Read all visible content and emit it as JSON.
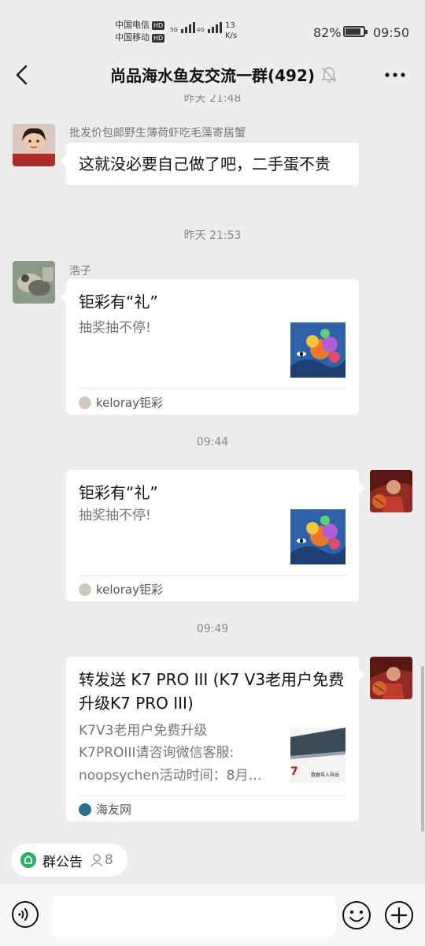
{
  "status_bar": {
    "carrier1": "中国电信",
    "carrier2": "中国移动",
    "hd": "HD",
    "net1": "5G",
    "net2": "4G",
    "speed_value": "13",
    "speed_unit": "K/s",
    "battery": "82%",
    "time": "09:50"
  },
  "header": {
    "title": "尚品海水鱼友交流一群(492)"
  },
  "chat": {
    "top_timestamp": "昨天 21:48",
    "messages": [
      {
        "sender": "批发价包邮野生薄荷虾吃毛藻寄居蟹",
        "text": "这就没必要自己做了吧，二手蛋不贵"
      },
      {
        "timestamp": "昨天 21:53",
        "sender": "浩子",
        "card_title": "钜彩有“礼”",
        "card_desc": "抽奖抽不停!",
        "card_source": "keloray钜彩"
      },
      {
        "timestamp": "09:44",
        "card_title": "钜彩有“礼”",
        "card_desc": "抽奖抽不停!",
        "card_source": "keloray钜彩"
      },
      {
        "timestamp": "09:49",
        "card_title": "转发送 K7 PRO III (K7 V3老用户免费升级K7 PRO III)",
        "card_desc_lines": [
          "K7V3老用户免费升级",
          "K7PROIII请咨询微信客服:",
          "noopsychen活动时间：8月…"
        ],
        "card_source": "海友网",
        "thumb_text": "数据导入导出",
        "thumb_brand": "7"
      }
    ]
  },
  "group_notice": {
    "label": "群公告",
    "member_count": "8"
  },
  "input_bar": {
    "placeholder": ""
  },
  "colors": {
    "background": "#ededed",
    "bubble": "#ffffff",
    "accent_green": "#2aae67"
  }
}
